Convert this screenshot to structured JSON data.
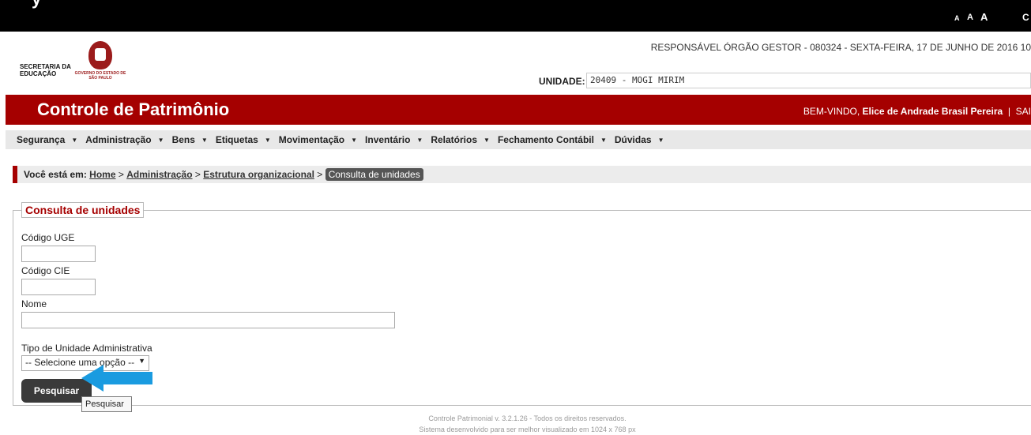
{
  "topbar": {
    "title_fragment": "y",
    "font_controls": [
      "A",
      "A",
      "A"
    ],
    "extra": "C"
  },
  "header": {
    "responsavel": "RESPONSÁVEL ÓRGÃO GESTOR - 080324 - SEXTA-FEIRA, 17 DE JUNHO DE 2016 10",
    "logo_secretaria": "SECRETARIA DA EDUCAÇÃO",
    "logo_governo": "GOVERNO DO ESTADO DE SÃO PAULO",
    "unidade_label": "UNIDADE:",
    "unidade_value": "20409 - MOGI MIRIM"
  },
  "app": {
    "title": "Controle de Patrimônio",
    "welcome_prefix": "BEM-VINDO,",
    "user": "Elice de Andrade Brasil Pereira",
    "sep": "|",
    "logout": "SAI"
  },
  "menu": {
    "items": [
      {
        "label": "Segurança"
      },
      {
        "label": "Administração"
      },
      {
        "label": "Bens"
      },
      {
        "label": "Etiquetas"
      },
      {
        "label": "Movimentação"
      },
      {
        "label": "Inventário"
      },
      {
        "label": "Relatórios"
      },
      {
        "label": "Fechamento Contábil"
      },
      {
        "label": "Dúvidas"
      }
    ]
  },
  "breadcrumb": {
    "prefix": "Você está em:",
    "home": "Home",
    "admin": "Administração",
    "estrutura": "Estrutura organizacional",
    "current": "Consulta de unidades"
  },
  "form": {
    "legend": "Consulta de unidades",
    "codigo_uge_label": "Código UGE",
    "codigo_cie_label": "Código CIE",
    "nome_label": "Nome",
    "tipo_label": "Tipo de Unidade Administrativa",
    "tipo_selected": "-- Selecione uma opção --",
    "search_button": "Pesquisar",
    "tooltip": "Pesquisar"
  },
  "footer": {
    "line1": "Controle Patrimonial v. 3.2.1.26 - Todos os direitos reservados.",
    "line2": "Sistema desenvolvido para ser melhor visualizado em 1024 x 768 px"
  },
  "colors": {
    "brand_red": "#a50000",
    "arrow_blue": "#1a9be0"
  }
}
